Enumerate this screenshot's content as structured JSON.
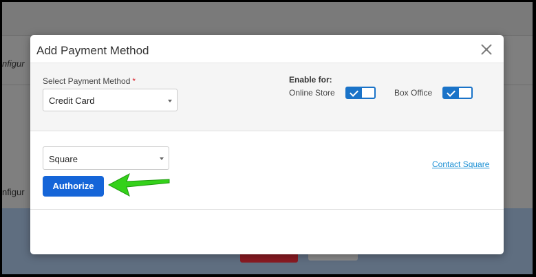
{
  "background": {
    "left_text_1": "nfigur",
    "left_text_2": "nfigur"
  },
  "modal": {
    "title": "Add Payment Method",
    "close_icon": "close-icon",
    "select_payment": {
      "label": "Select Payment Method",
      "required_mark": "*",
      "value": "Credit Card"
    },
    "enable_for": {
      "label": "Enable for:",
      "toggles": [
        {
          "label": "Online Store",
          "enabled": true
        },
        {
          "label": "Box Office",
          "enabled": true
        }
      ]
    },
    "processor": {
      "value": "Square"
    },
    "contact_link": "Contact Square",
    "authorize_button": "Authorize"
  },
  "colors": {
    "primary": "#1565d8",
    "toggle": "#1a73c8",
    "link": "#1a8fd4",
    "annotation_arrow": "#34d11a",
    "required": "#d9232e"
  }
}
